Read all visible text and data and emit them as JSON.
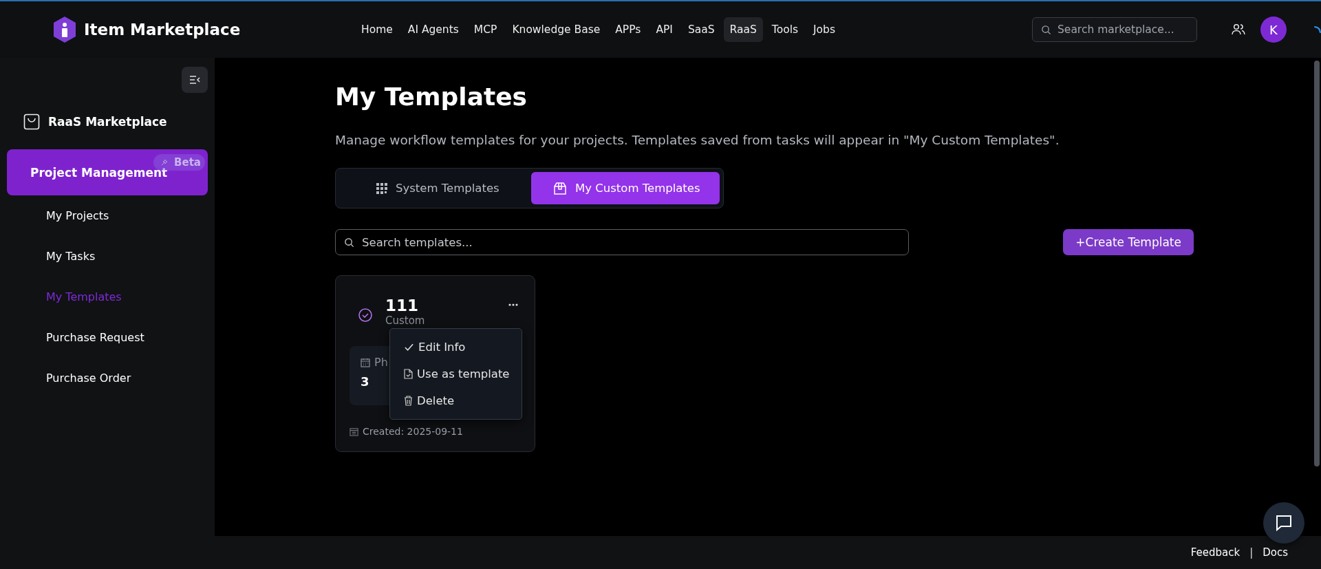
{
  "header": {
    "logo": "Item Marketplace",
    "nav": [
      {
        "label": "Home",
        "selected": false
      },
      {
        "label": "AI Agents",
        "selected": false
      },
      {
        "label": "MCP",
        "selected": false
      },
      {
        "label": "Knowledge Base",
        "selected": false
      },
      {
        "label": "APPs",
        "selected": false
      },
      {
        "label": "API",
        "selected": false
      },
      {
        "label": "SaaS",
        "selected": false
      },
      {
        "label": "RaaS",
        "selected": true
      },
      {
        "label": "Tools",
        "selected": false
      },
      {
        "label": "Jobs",
        "selected": false
      }
    ],
    "search": {
      "placeholder": "Search marketplace..."
    },
    "avatar": "K"
  },
  "sidebar": {
    "section": "RaaS Marketplace",
    "group": {
      "label": "Project Management",
      "badge": "Beta",
      "selected": true
    },
    "items": [
      {
        "label": "My Projects",
        "selected": false
      },
      {
        "label": "My Tasks",
        "selected": false
      },
      {
        "label": "My Templates",
        "selected": true
      },
      {
        "label": "Purchase Request",
        "selected": false
      },
      {
        "label": "Purchase Order",
        "selected": false
      }
    ]
  },
  "page": {
    "title": "My Templates",
    "description": "Manage workflow templates for your projects. Templates saved from tasks will appear in \"My Custom Templates\".",
    "tabs": [
      {
        "kind": "system",
        "label": "System Templates",
        "selected": false
      },
      {
        "kind": "custom",
        "label": "My Custom Templates",
        "selected": true
      }
    ],
    "search": {
      "placeholder": "Search templates..."
    },
    "create_button": "+Create Template"
  },
  "card": {
    "title": "111",
    "subtitle": "Custom",
    "stat": {
      "label": "Ph",
      "value": "3"
    },
    "created": "Created: 2025-09-11"
  },
  "menu": [
    {
      "kind": "edit",
      "label": "Edit Info"
    },
    {
      "kind": "use",
      "label": "Use as template"
    },
    {
      "kind": "delete",
      "label": "Delete"
    }
  ],
  "footer": {
    "links": [
      "Feedback",
      "Docs"
    ],
    "separator": "|"
  }
}
